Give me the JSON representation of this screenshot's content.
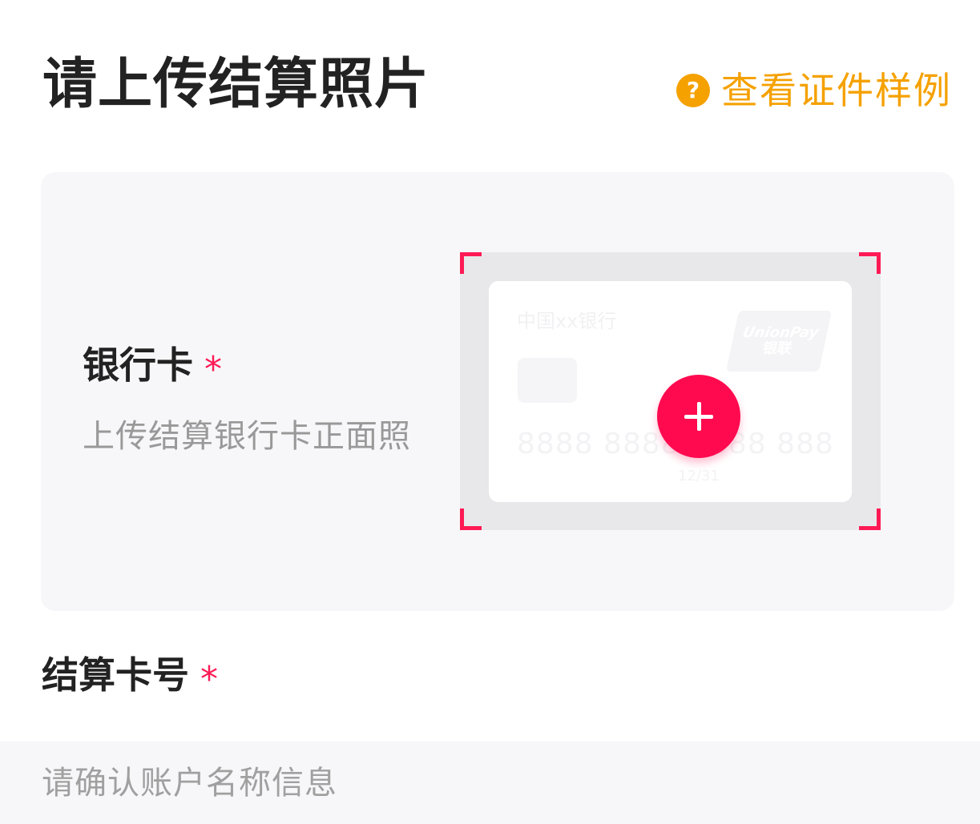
{
  "header": {
    "title": "请上传结算照片",
    "sample_link": {
      "icon": "question-icon",
      "icon_glyph": "?",
      "label": "查看证件样例"
    }
  },
  "upload_section": {
    "label": "银行卡",
    "required_mark": "*",
    "description": "上传结算银行卡正面照",
    "card_preview": {
      "bank_name": "中国xx银行",
      "logo_en": "UnionPay",
      "logo_cn": "银联",
      "card_number": "8888  8888  8888 888",
      "expiry": "12/31"
    },
    "add_button_icon": "plus-icon"
  },
  "card_number_field": {
    "label": "结算卡号",
    "required_mark": "*",
    "placeholder": "请确认账户名称信息",
    "value": ""
  },
  "colors": {
    "accent": "#ff0a4f",
    "link": "#f5a100",
    "panel_bg": "#f7f7f9",
    "frame_bg": "#e8e8ea"
  }
}
